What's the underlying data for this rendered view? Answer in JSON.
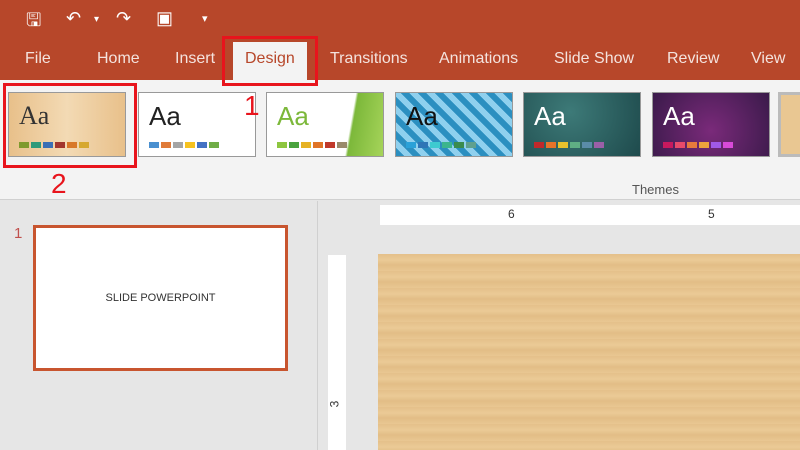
{
  "quick_access": {
    "save": "save-icon",
    "undo": "undo-icon",
    "redo": "redo-icon",
    "present": "present-from-start-icon",
    "customize": "customize-icon"
  },
  "tabs": [
    "File",
    "Home",
    "Insert",
    "Design",
    "Transitions",
    "Animations",
    "Slide Show",
    "Review",
    "View"
  ],
  "active_tab": "Design",
  "themes": {
    "label": "Themes",
    "items": [
      {
        "sample": "Aa",
        "colors": [
          "#7f9a2d",
          "#2e9a7a",
          "#3a6fb5",
          "#a2362e",
          "#d8782a",
          "#d6a82f"
        ]
      },
      {
        "sample": "Aa",
        "colors": [
          "#4a90d0",
          "#e07b39",
          "#a5a5a5",
          "#f6c221",
          "#4472c4",
          "#70ad47"
        ]
      },
      {
        "sample": "Aa",
        "colors": [
          "#8dc63f",
          "#4aa33e",
          "#e6b224",
          "#e07426",
          "#c0392b",
          "#998a6a"
        ]
      },
      {
        "sample": "Aa",
        "colors": [
          "#2aa1d8",
          "#2e75b6",
          "#3ecad0",
          "#3bb58e",
          "#3a8b4e",
          "#5fa08f"
        ]
      },
      {
        "sample": "Aa",
        "colors": [
          "#c0292b",
          "#e6732a",
          "#e8c12c",
          "#5fae84",
          "#5a8ca8",
          "#9a5fa8"
        ]
      },
      {
        "sample": "Aa",
        "colors": [
          "#c8195e",
          "#e84a6a",
          "#e67a3c",
          "#eca33c",
          "#a05ae6",
          "#d84ad8"
        ]
      }
    ]
  },
  "annotations": {
    "one": "1",
    "two": "2"
  },
  "slides": [
    {
      "number": "1",
      "title": "SLIDE POWERPOINT"
    }
  ],
  "ruler": {
    "h": [
      "6",
      "5"
    ],
    "v": [
      "3"
    ]
  }
}
